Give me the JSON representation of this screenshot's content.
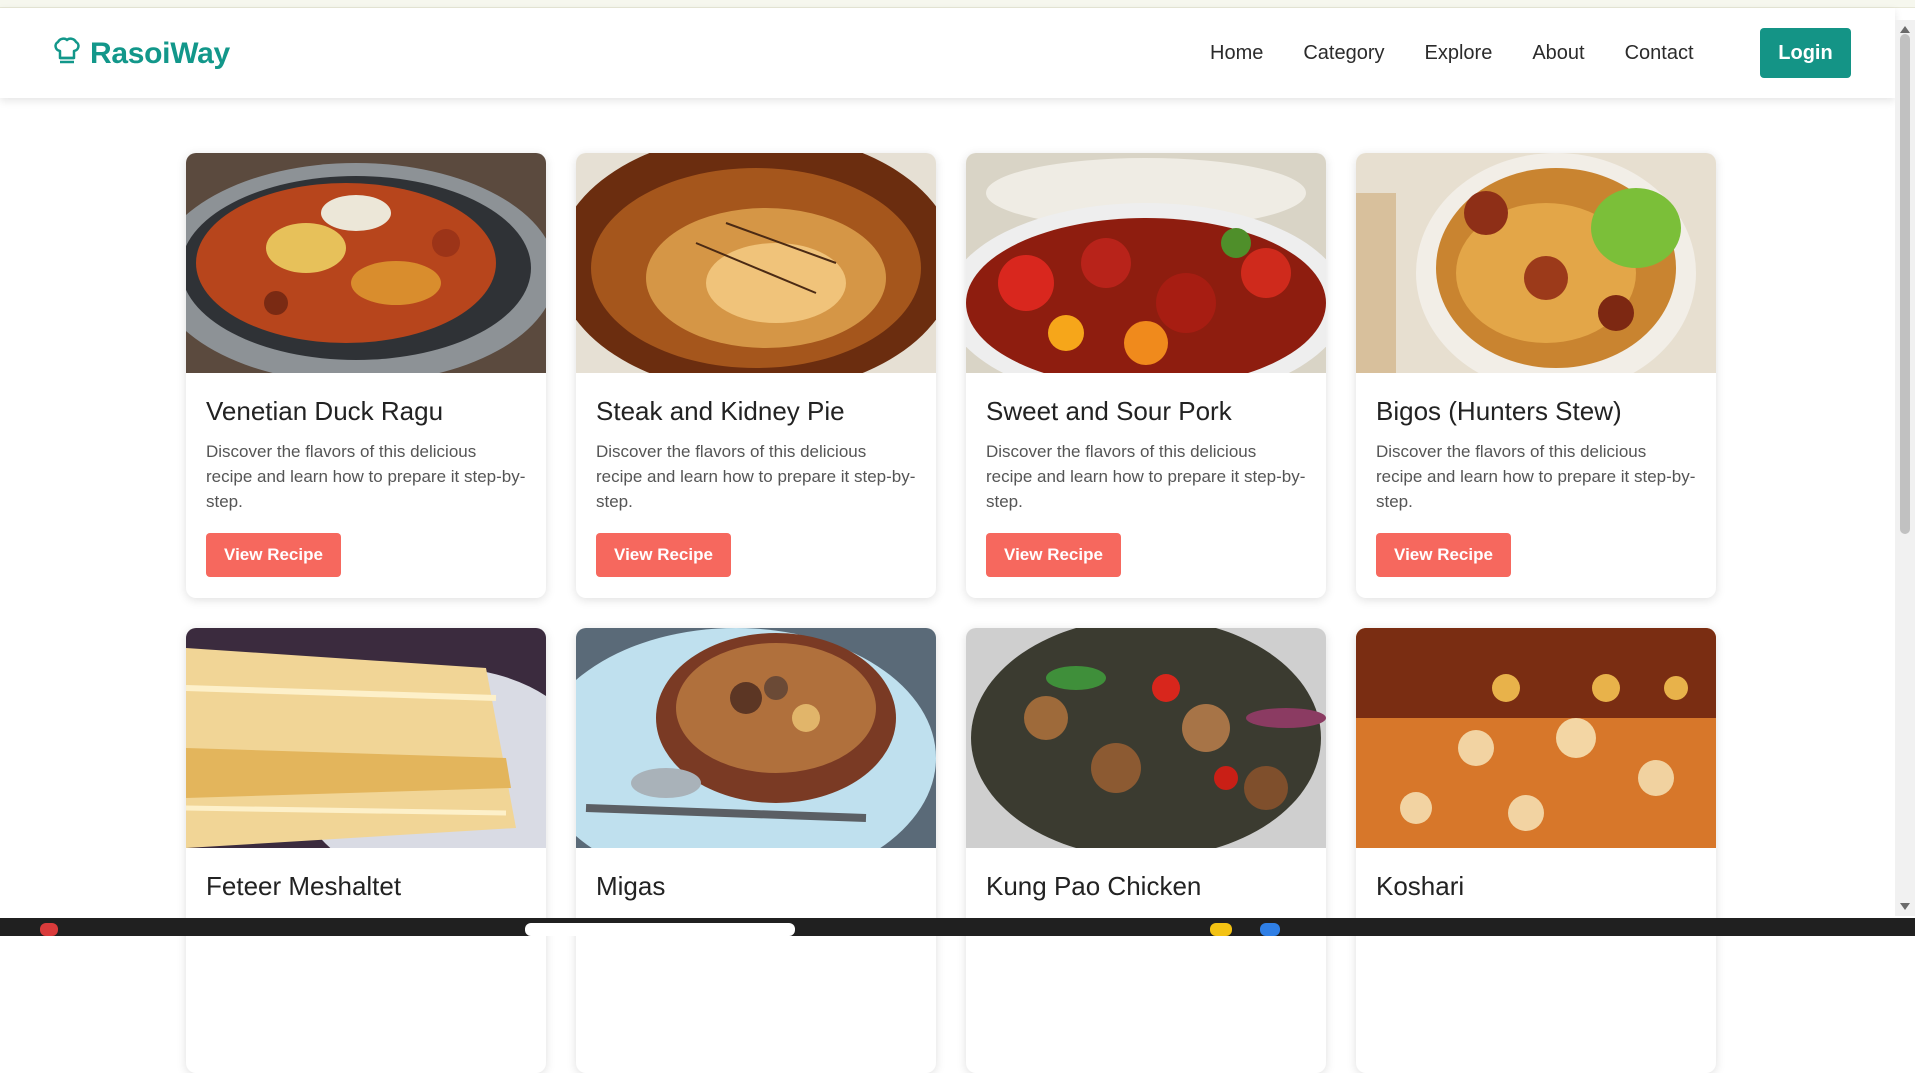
{
  "brand": {
    "name": "RasoiWay",
    "color": "#12978a",
    "icon": "chef-hat-icon"
  },
  "nav": {
    "links": [
      "Home",
      "Category",
      "Explore",
      "About",
      "Contact"
    ],
    "login_label": "Login",
    "login_color": "#149486"
  },
  "recipes": [
    {
      "title": "Venetian Duck Ragu",
      "description": "Discover the flavors of this delicious recipe and learn how to prepare it step-by-step.",
      "button": "View Recipe"
    },
    {
      "title": "Steak and Kidney Pie",
      "description": "Discover the flavors of this delicious recipe and learn how to prepare it step-by-step.",
      "button": "View Recipe"
    },
    {
      "title": "Sweet and Sour Pork",
      "description": "Discover the flavors of this delicious recipe and learn how to prepare it step-by-step.",
      "button": "View Recipe"
    },
    {
      "title": "Bigos (Hunters Stew)",
      "description": "Discover the flavors of this delicious recipe and learn how to prepare it step-by-step.",
      "button": "View Recipe"
    },
    {
      "title": "Feteer Meshaltet",
      "description": "",
      "button": ""
    },
    {
      "title": "Migas",
      "description": "",
      "button": ""
    },
    {
      "title": "Kung Pao Chicken",
      "description": "",
      "button": ""
    },
    {
      "title": "Koshari",
      "description": "",
      "button": ""
    }
  ],
  "colors": {
    "accent": "#149486",
    "button": "#f6685e",
    "text": "#212529"
  }
}
